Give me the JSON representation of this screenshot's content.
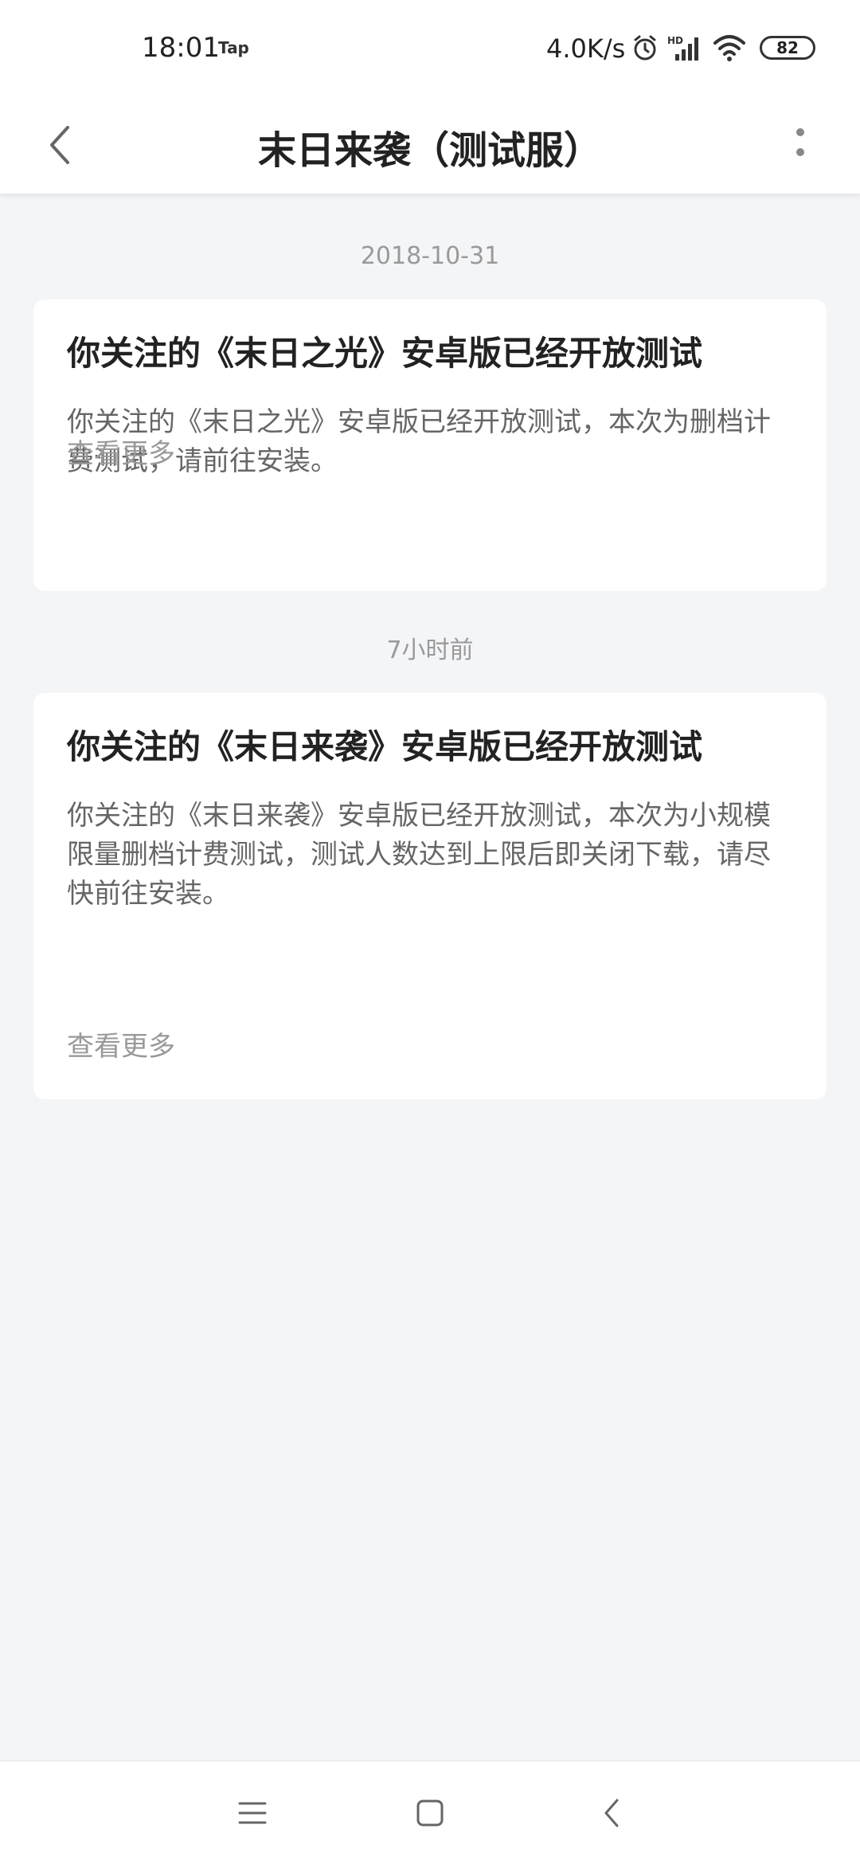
{
  "status_bar": {
    "time": "18:01",
    "app_indicator": "Tap",
    "network_speed": "4.0K/s",
    "battery": "82",
    "icons": [
      "alarm-icon",
      "hd-signal-icon",
      "wifi-icon",
      "battery-icon"
    ]
  },
  "header": {
    "title": "末日来袭（测试服）",
    "back_icon": "back-arrow-icon",
    "more_icon": "more-vertical-icon"
  },
  "feed": [
    {
      "date": "2018-10-31",
      "title": "你关注的《末日之光》安卓版已经开放测试",
      "body": "你关注的《末日之光》安卓版已经开放测试，本次为删档计费测试，请前往安装。",
      "more": "查看更多"
    },
    {
      "date": "7小时前",
      "title": "你关注的《末日来袭》安卓版已经开放测试",
      "body": "你关注的《末日来袭》安卓版已经开放测试，本次为小规模限量删档计费测试，测试人数达到上限后即关闭下载，请尽快前往安装。",
      "more": "查看更多"
    }
  ],
  "nav_bar": {
    "icons": [
      "menu-icon",
      "home-icon",
      "back-icon"
    ]
  },
  "colors": {
    "background": "#f4f5f7",
    "card": "#ffffff",
    "title_text": "#222222",
    "body_text": "#666666",
    "muted_text": "#999999"
  }
}
